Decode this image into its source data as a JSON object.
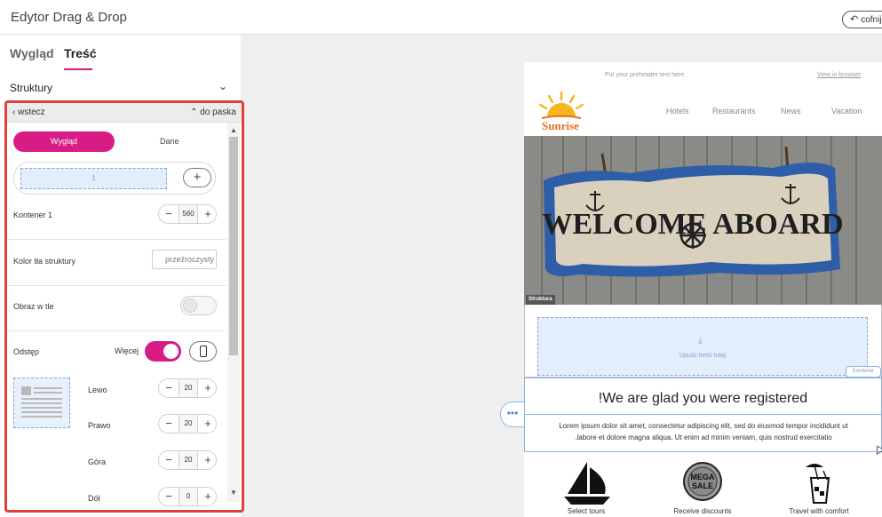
{
  "app": {
    "title": "Edytor Drag & Drop",
    "undo_label": "cofnij"
  },
  "panel": {
    "tabs": [
      {
        "label": "Wygląd"
      },
      {
        "label": "Treść"
      }
    ],
    "active_tab": "Treść",
    "section_label": "Struktury",
    "nav": {
      "back_label": "wstecz",
      "to_top_label": "do paska"
    },
    "subtabs": {
      "active": "Wygląd",
      "other": "Dane"
    },
    "layout_column_label": "1",
    "container": {
      "label": "Kontener 1",
      "value": "560"
    },
    "background_color": {
      "label": "Kolor tła struktury",
      "placeholder": "przeźroczysty"
    },
    "background_image": {
      "label": "Obraz w tle",
      "enabled": false
    },
    "spacing": {
      "label": "Odstęp",
      "more_label": "Więcej",
      "more_enabled": true,
      "left": {
        "label": "Lewo",
        "value": "20"
      },
      "right": {
        "label": "Prawo",
        "value": "20"
      },
      "top": {
        "label": "Góra",
        "value": "20"
      },
      "bottom": {
        "label": "Dół",
        "value": "0"
      }
    }
  },
  "email": {
    "preheader": "Put your preheader text here",
    "view_in_browser": "View in browser",
    "logo_text": "Sunrise",
    "nav": [
      "Hotels",
      "Restaurants",
      "News",
      "Vacation"
    ],
    "hero_sign_text": "WELCOME ABOARD",
    "structure_tag": "Struktura",
    "drop_zone_text": "Upuść treść tutaj",
    "container_tag": "Kontener",
    "heading": "!We are glad you were registered",
    "body_line1": "Lorem ipsum dolor sit amet, consectetur adipiscing elit, sed do eiusmod tempor incididunt ut",
    "body_line2": ".labore et dolore magna aliqua. Ut enim ad minim veniam, quis nostrud exercitatio",
    "features": [
      {
        "icon": "sailboat-icon",
        "caption": "Select tours"
      },
      {
        "icon": "mega-sale-icon",
        "badge_line1": "MEGA",
        "badge_line2": "SALE",
        "caption": "Receive discounts"
      },
      {
        "icon": "cocktail-icon",
        "caption": "Travel with comfort"
      }
    ]
  },
  "colors": {
    "accent": "#d81b85",
    "highlight_border": "#e0403a",
    "selection_blue": "#8db3e2"
  }
}
